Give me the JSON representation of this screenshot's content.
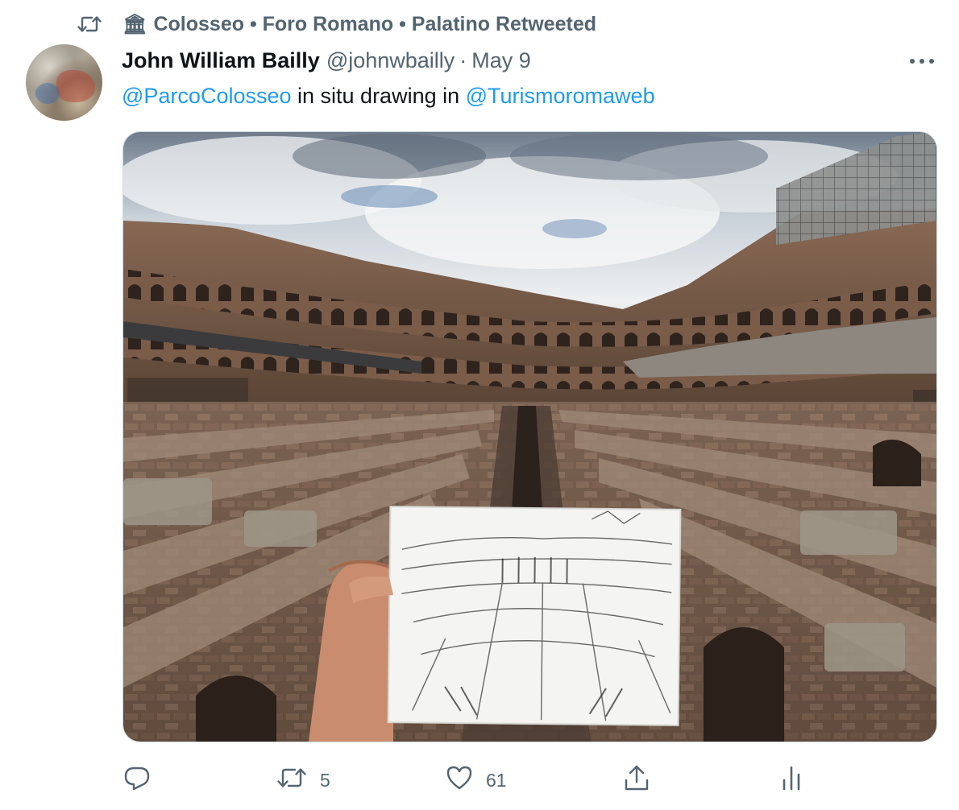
{
  "retweet_banner": {
    "icon": "retweet-icon",
    "emoji": "🏛",
    "text": "Colosseo • Foro Romano • Palatino Retweeted"
  },
  "tweet": {
    "author": {
      "name": "John William Bailly",
      "handle": "@johnwbailly",
      "separator": "·",
      "date": "May 9"
    },
    "text": {
      "mention1": "@ParcoColosseo",
      "middle": " in situ drawing in ",
      "mention2": "@Turismoromaweb"
    },
    "media": {
      "icon": "photo-colosseum-with-sketch"
    },
    "actions": {
      "reply": {
        "icon": "reply-icon",
        "count": ""
      },
      "retweet": {
        "icon": "retweet-icon",
        "count": "5"
      },
      "like": {
        "icon": "heart-icon",
        "count": "61"
      },
      "share": {
        "icon": "share-icon"
      },
      "analytics": {
        "icon": "analytics-icon"
      }
    },
    "more": {
      "icon": "more-options-icon"
    }
  },
  "colors": {
    "text_primary": "#0f1419",
    "text_secondary": "#536471",
    "link": "#1d9bf0"
  }
}
